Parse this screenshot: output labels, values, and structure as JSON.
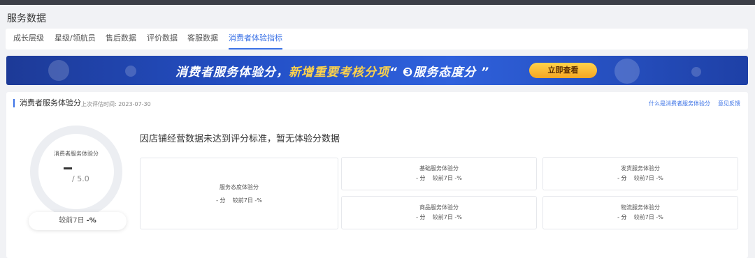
{
  "page_title": "服务数据",
  "tabs": [
    {
      "label": "成长层级"
    },
    {
      "label": "星级/领航员"
    },
    {
      "label": "售后数据"
    },
    {
      "label": "评价数据"
    },
    {
      "label": "客服数据"
    },
    {
      "label": "消费者体验指标",
      "active": true
    }
  ],
  "banner": {
    "text_prefix": "消费者服务体验分，",
    "text_highlight": "新增重要考核分项",
    "text_suffix": "“ ❸服务态度分 ”",
    "button": "立即查看"
  },
  "card": {
    "title": "消费者服务体验分",
    "subtitle": "上次评估时间: 2023-07-30",
    "link_what": "什么是消费者服务体验分",
    "link_feedback": "意见反馈",
    "gauge": {
      "label": "消费者服务体验分",
      "total": "/ 5.0",
      "compare_label": "较前7日",
      "compare_value": "-%"
    },
    "notice": "因店铺经营数据未达到评分标准，暂无体验分数据",
    "metrics": [
      {
        "name": "服务态度体验分",
        "score": "- 分",
        "compare": "较前7日 -%"
      },
      {
        "name": "基础服务体验分",
        "score": "- 分",
        "compare": "较前7日 -%"
      },
      {
        "name": "发货服务体验分",
        "score": "- 分",
        "compare": "较前7日 -%"
      },
      {
        "name": "商品服务体验分",
        "score": "- 分",
        "compare": "较前7日 -%"
      },
      {
        "name": "物流服务体验分",
        "score": "- 分",
        "compare": "较前7日 -%"
      }
    ]
  },
  "colors": {
    "accent": "#3b72e6",
    "banner_dark": "#1d3a97",
    "banner_highlight": "#ffd34a",
    "button": "#f5a623"
  }
}
